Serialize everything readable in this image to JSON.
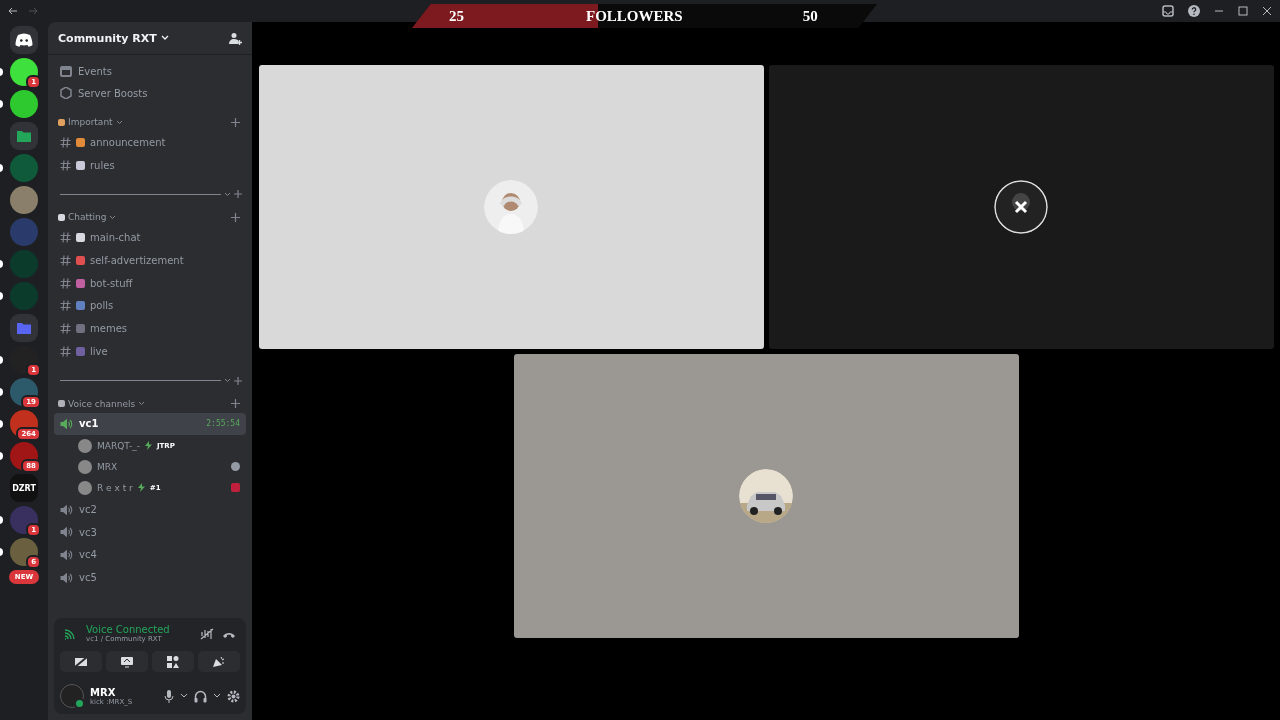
{
  "followers": {
    "start": "25",
    "label": "FOLLOWERS",
    "end": "50",
    "level": 0.4
  },
  "servers": [
    {
      "kind": "logo"
    },
    {
      "kind": "icon",
      "color": "#3ee03e",
      "badge": "1",
      "unread": true
    },
    {
      "kind": "icon",
      "color": "#2ec92e",
      "unread": true
    },
    {
      "kind": "folder",
      "color": "#23a55a"
    },
    {
      "kind": "icon",
      "color": "#0f5a3a",
      "unread": true
    },
    {
      "kind": "icon",
      "color": "#8a7f6a",
      "unread": false
    },
    {
      "kind": "icon",
      "color": "#2a3a6a",
      "unread": false
    },
    {
      "kind": "icon",
      "color": "#0b3b2b",
      "unread": true
    },
    {
      "kind": "icon",
      "color": "#0b3b2b",
      "unread": true
    },
    {
      "kind": "folder",
      "color": "#5865f2"
    },
    {
      "kind": "icon",
      "color": "#222222",
      "badge": "1",
      "unread": true
    },
    {
      "kind": "icon",
      "color": "#2d5a6a",
      "badge": "19",
      "unread": true
    },
    {
      "kind": "icon",
      "color": "#c0301c",
      "badge": "264",
      "unread": true
    },
    {
      "kind": "icon",
      "color": "#a01515",
      "badge": "88",
      "unread": true
    },
    {
      "kind": "text",
      "color": "#111111",
      "label": "DZRT"
    },
    {
      "kind": "icon",
      "color": "#3a3060",
      "badge": "1",
      "unread": true
    },
    {
      "kind": "icon",
      "color": "#6a6040",
      "badge": "6",
      "unread": true
    },
    {
      "kind": "new",
      "label": "NEW"
    }
  ],
  "sidebar": {
    "server_name": "Community RXT",
    "top_items": [
      {
        "kind": "events",
        "label": "Events"
      },
      {
        "kind": "boosts",
        "label": "Server Boosts"
      }
    ],
    "categories": [
      {
        "name": "Important",
        "color": "#e0a060",
        "channels": [
          {
            "kind": "text",
            "name": "announcement",
            "color": "#e08a3a"
          },
          {
            "kind": "text",
            "name": "rules",
            "color": "#c8c8d8"
          }
        ]
      },
      {
        "kind": "divider"
      },
      {
        "name": "Chatting",
        "color": "#d8d8e0",
        "channels": [
          {
            "kind": "text",
            "name": "main-chat",
            "color": "#d8d8e0"
          },
          {
            "kind": "text",
            "name": "self-advertizement",
            "color": "#e05050"
          },
          {
            "kind": "text",
            "name": "bot-stuff",
            "color": "#c060a0"
          },
          {
            "kind": "text",
            "name": "polls",
            "color": "#6080c0"
          },
          {
            "kind": "text",
            "name": "memes",
            "color": "#707080"
          },
          {
            "kind": "text",
            "name": "live",
            "color": "#7060a0"
          }
        ]
      },
      {
        "kind": "divider"
      },
      {
        "name": "Voice channels",
        "color": "#b0b0b8",
        "channels": [
          {
            "kind": "voice",
            "name": "vc1",
            "selected": true,
            "time": "2:55:54",
            "members": [
              {
                "name": "MARQT-_-",
                "tag": "JTRP"
              },
              {
                "name": "MRX",
                "kind": "emoji"
              },
              {
                "name": "R e x t r",
                "tag": "#1",
                "kind": "app"
              }
            ]
          },
          {
            "kind": "voice",
            "name": "vc2",
            "selected": false
          },
          {
            "kind": "voice",
            "name": "vc3",
            "selected": false
          },
          {
            "kind": "voice",
            "name": "vc4",
            "selected": false
          },
          {
            "kind": "voice",
            "name": "vc5",
            "selected": false
          }
        ]
      }
    ]
  },
  "voice_panel": {
    "status": "Voice Connected",
    "location": "vc1 / Community RXT"
  },
  "user": {
    "name": "MRX",
    "status": "kick :MRX_S"
  },
  "tiles": [
    {
      "color": "#d9d9d9",
      "kind": "person"
    },
    {
      "color": "#1a1a1a",
      "kind": "muted"
    },
    {
      "color": "#9b9893",
      "kind": "car"
    }
  ]
}
